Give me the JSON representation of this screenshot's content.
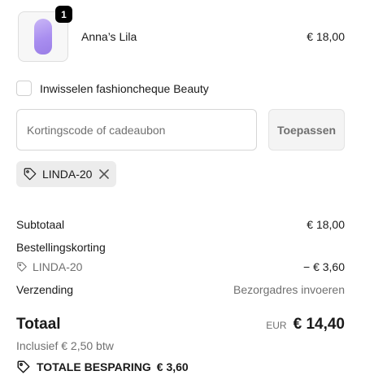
{
  "product": {
    "name": "Anna’s Lila",
    "price": "€ 18,00",
    "quantity": "1"
  },
  "gift_cheque": {
    "label": "Inwisselen fashioncheque Beauty",
    "checked": false
  },
  "discount": {
    "placeholder": "Kortingscode of cadeaubon",
    "value": "",
    "apply_label": "Toepassen",
    "applied_code": "LINDA-20"
  },
  "summary": {
    "subtotal_label": "Subtotaal",
    "subtotal_value": "€ 18,00",
    "order_discount_label": "Bestellingskorting",
    "discount_code": "LINDA-20",
    "discount_value": "− € 3,60",
    "shipping_label": "Verzending",
    "shipping_value": "Bezorgadres invoeren"
  },
  "total": {
    "label": "Totaal",
    "currency": "EUR",
    "amount": "€ 14,40",
    "vat_note": "Inclusief € 2,50 btw",
    "savings_label": "TOTALE BESPARING",
    "savings_amount": "€ 3,60"
  },
  "icons": [
    "tag-icon",
    "close-icon"
  ],
  "colors": {
    "accent": "#000000",
    "muted": "#707070",
    "chip_bg": "#ececec"
  }
}
